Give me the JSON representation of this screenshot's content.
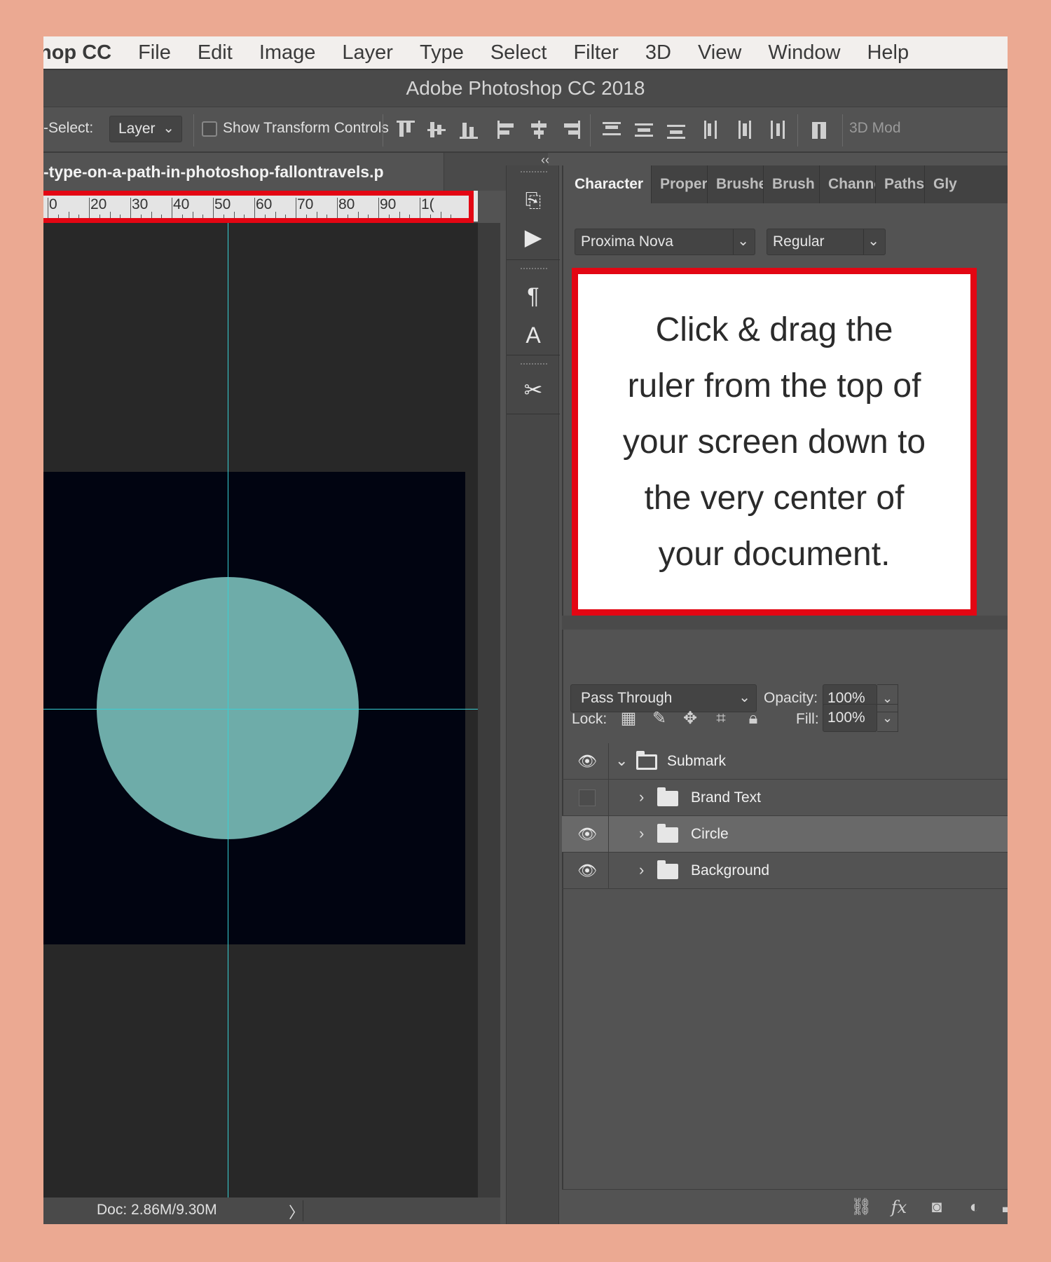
{
  "menubar": {
    "app_name": "hop CC",
    "items": [
      "File",
      "Edit",
      "Image",
      "Layer",
      "Type",
      "Select",
      "Filter",
      "3D",
      "View",
      "Window",
      "Help"
    ]
  },
  "window": {
    "title": "Adobe Photoshop CC 2018"
  },
  "options_bar": {
    "auto_select_label": "-Select:",
    "auto_select_value": "Layer",
    "show_transform_label": "Show Transform Controls",
    "mode_3d_label": "3D Mod"
  },
  "document": {
    "tab_title": "-type-on-a-path-in-photoshop-fallontravels.p",
    "ruler_labels": [
      "0",
      "20",
      "30",
      "40",
      "50",
      "60",
      "70",
      "80",
      "90",
      "1("
    ],
    "status": "Doc: 2.86M/9.30M",
    "status_arrow": "〉"
  },
  "character_panel": {
    "tabs": [
      "Character",
      "Proper",
      "Brushe",
      "Brush S",
      "Channe",
      "Paths",
      "Gly"
    ],
    "font_family": "Proxima Nova",
    "font_style": "Regular"
  },
  "callout": {
    "lines": [
      "Click & drag the",
      "ruler from the top of",
      "your screen down to",
      "the very center of",
      "your document."
    ]
  },
  "layers_panel": {
    "blend_mode": "Pass Through",
    "opacity_label": "Opacity:",
    "opacity_value": "100%",
    "lock_label": "Lock:",
    "fill_label": "Fill:",
    "fill_value": "100%",
    "layers": [
      {
        "name": "Submark",
        "visible": true,
        "expanded": true,
        "level": 0
      },
      {
        "name": "Brand Text",
        "visible": false,
        "expanded": false,
        "level": 1
      },
      {
        "name": "Circle",
        "visible": true,
        "expanded": false,
        "level": 1,
        "selected": true
      },
      {
        "name": "Background",
        "visible": true,
        "expanded": false,
        "level": 1
      }
    ]
  },
  "colors": {
    "page_background": "#eba992",
    "highlight_red": "#e30613",
    "guide_cyan": "#38d0d4",
    "circle_teal": "#6eaca9",
    "document_fill": "#010411"
  }
}
